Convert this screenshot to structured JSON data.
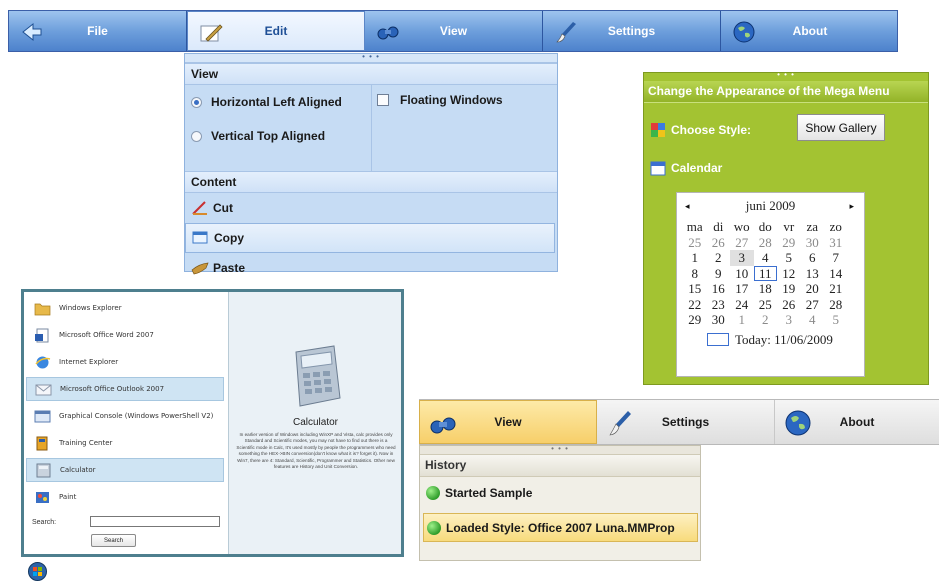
{
  "colors": {
    "accent": "#4d82cc",
    "green_panel": "#a3c332",
    "highlight_yellow": "#f7cf6a"
  },
  "top_menu": {
    "items": [
      {
        "label": "File",
        "icon": "arrow-icon"
      },
      {
        "label": "Edit",
        "icon": "notepad-icon",
        "active": true
      },
      {
        "label": "View",
        "icon": "binoculars-icon"
      },
      {
        "label": "Settings",
        "icon": "brush-icon"
      },
      {
        "label": "About",
        "icon": "globe-icon"
      }
    ]
  },
  "edit_dropdown": {
    "grip": "• • •",
    "view_header": "View",
    "horizontal_label": "Horizontal Left Aligned",
    "vertical_label": "Vertical Top Aligned",
    "floating_label": "Floating Windows",
    "selected_option": "Horizontal Left Aligned",
    "content_header": "Content",
    "cut_label": "Cut",
    "copy_label": "Copy",
    "paste_label": "Paste"
  },
  "appearance_panel": {
    "grip": "• • •",
    "title": "Change the Appearance of the Mega Menu",
    "choose_style_label": "Choose Style:",
    "show_gallery_label": "Show Gallery",
    "calendar_label": "Calendar",
    "calendar": {
      "month_title": "juni 2009",
      "prev": "◂",
      "next": "▸",
      "weekdays": [
        "ma",
        "di",
        "wo",
        "do",
        "vr",
        "za",
        "zo"
      ],
      "days": [
        [
          "25",
          "26",
          "27",
          "28",
          "29",
          "30",
          "31"
        ],
        [
          "1",
          "2",
          "3",
          "4",
          "5",
          "6",
          "7"
        ],
        [
          "8",
          "9",
          "10",
          "11",
          "12",
          "13",
          "14"
        ],
        [
          "15",
          "16",
          "17",
          "18",
          "19",
          "20",
          "21"
        ],
        [
          "22",
          "23",
          "24",
          "25",
          "26",
          "27",
          "28"
        ],
        [
          "29",
          "30",
          "1",
          "2",
          "3",
          "4",
          "5"
        ]
      ],
      "today_text": "Today: 11/06/2009"
    }
  },
  "start_menu": {
    "items": [
      {
        "label": "Windows Explorer",
        "icon": "folder-icon"
      },
      {
        "label": "Microsoft Office Word 2007",
        "icon": "word-icon"
      },
      {
        "label": "Internet Explorer",
        "icon": "internet-explorer-icon"
      },
      {
        "label": "Microsoft Office Outlook 2007",
        "icon": "outlook-icon",
        "highlighted": true
      },
      {
        "label": "Graphical Console (Windows PowerShell V2)",
        "icon": "console-icon"
      },
      {
        "label": "Training Center",
        "icon": "book-icon"
      },
      {
        "label": "Calculator",
        "icon": "calculator-icon",
        "highlighted": true
      },
      {
        "label": "Paint",
        "icon": "paint-icon"
      }
    ],
    "search_label": "Search:",
    "search_value": "",
    "search_button": "Search",
    "preview_title": "Calculator",
    "preview_text": "In earlier version of Windows including WinXP and Vista, calc provides only Standard and Scientific modes, you may not have to find out there is a Scientific mode in Calc, It's used mostly by people the programmers who need something the HEX->BIN conversion(don't know what it is? forget it). Now in Win7, there are 4: Standard, Scientific, Programmer and Statistics. Other new features are History and Unit Conversion."
  },
  "second_menu": {
    "items": [
      {
        "label": "View",
        "icon": "binoculars-icon",
        "active": true
      },
      {
        "label": "Settings",
        "icon": "brush-icon"
      },
      {
        "label": "About",
        "icon": "globe-icon"
      }
    ]
  },
  "history_panel": {
    "grip": "• • •",
    "header": "History",
    "entries": [
      {
        "label": "Started Sample"
      },
      {
        "label": "Loaded Style: Office 2007 Luna.MMProp",
        "highlighted": true
      }
    ]
  }
}
